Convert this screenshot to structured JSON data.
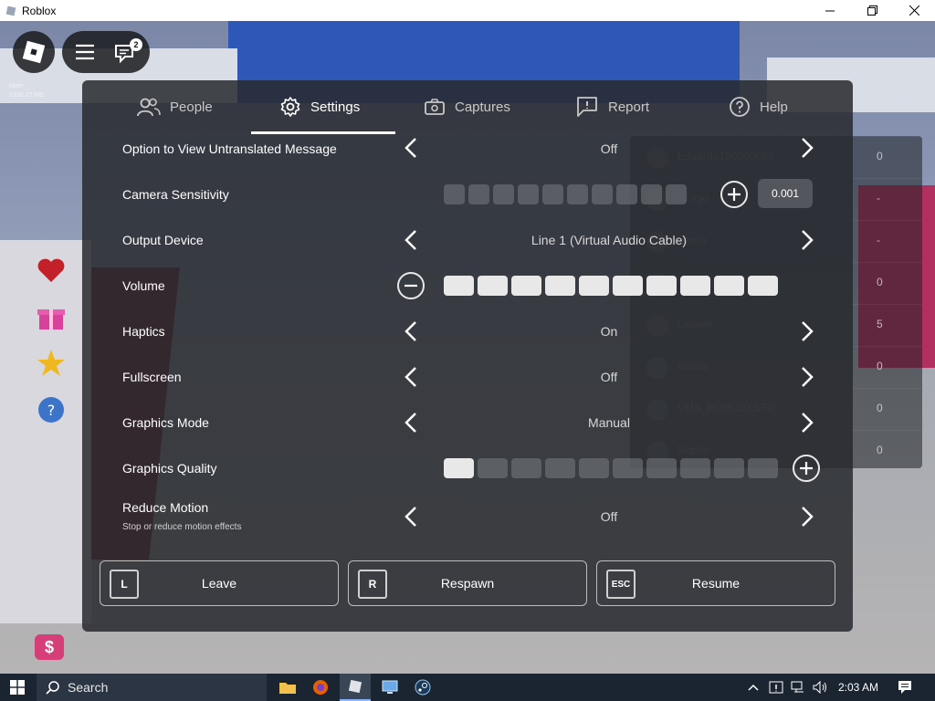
{
  "window": {
    "title": "Roblox",
    "minimize_icon": "minimize-icon",
    "maximize_icon": "restore-icon",
    "close_icon": "close-icon"
  },
  "hud": {
    "chat_badge": "2",
    "memory_label": "Mem",
    "memory_value": "1336.27 MB"
  },
  "tabs": [
    {
      "label": "People",
      "icon": "people-icon"
    },
    {
      "label": "Settings",
      "icon": "gear-icon",
      "active": true
    },
    {
      "label": "Captures",
      "icon": "camera-icon"
    },
    {
      "label": "Report",
      "icon": "flag-icon"
    },
    {
      "label": "Help",
      "icon": "help-icon"
    }
  ],
  "settings": {
    "untranslated": {
      "label": "Option to View Untranslated Message",
      "value": "Off"
    },
    "camera_sensitivity": {
      "label": "Camera Sensitivity",
      "value": "0.001",
      "level": 0
    },
    "output_device": {
      "label": "Output Device",
      "value": "Line 1 (Virtual Audio Cable)"
    },
    "volume": {
      "label": "Volume",
      "level": 10,
      "max": 10
    },
    "haptics": {
      "label": "Haptics",
      "value": "On"
    },
    "fullscreen": {
      "label": "Fullscreen",
      "value": "Off"
    },
    "graphics_mode": {
      "label": "Graphics Mode",
      "value": "Manual"
    },
    "graphics_quality": {
      "label": "Graphics Quality",
      "level": 1,
      "max": 10
    },
    "reduce_motion": {
      "label": "Reduce Motion",
      "sublabel": "Stop or reduce motion effects",
      "value": "Off"
    }
  },
  "players": [
    {
      "name": "Eduardo150000089",
      "value": "0"
    },
    {
      "name": "Chinjo",
      "value": "-"
    },
    {
      "name": "Gloria",
      "value": "-"
    },
    {
      "name": "Criminallyamazing",
      "value": "0"
    },
    {
      "name": "Lauwie",
      "value": "5"
    },
    {
      "name": "ballius",
      "value": "0"
    },
    {
      "name": "VMS_ROBLOXSER",
      "value": "0"
    },
    {
      "name": "Sophie",
      "value": "0"
    }
  ],
  "bottom": {
    "leave": {
      "key": "L",
      "label": "Leave"
    },
    "respawn": {
      "key": "R",
      "label": "Respawn"
    },
    "resume": {
      "key": "ESC",
      "label": "Resume"
    }
  },
  "taskbar": {
    "search_placeholder": "Search",
    "time": "2:03 AM"
  },
  "colors": {
    "panel": "#282a2e",
    "accent_pink": "#d63e7a",
    "taskbar": "#1b2431"
  }
}
